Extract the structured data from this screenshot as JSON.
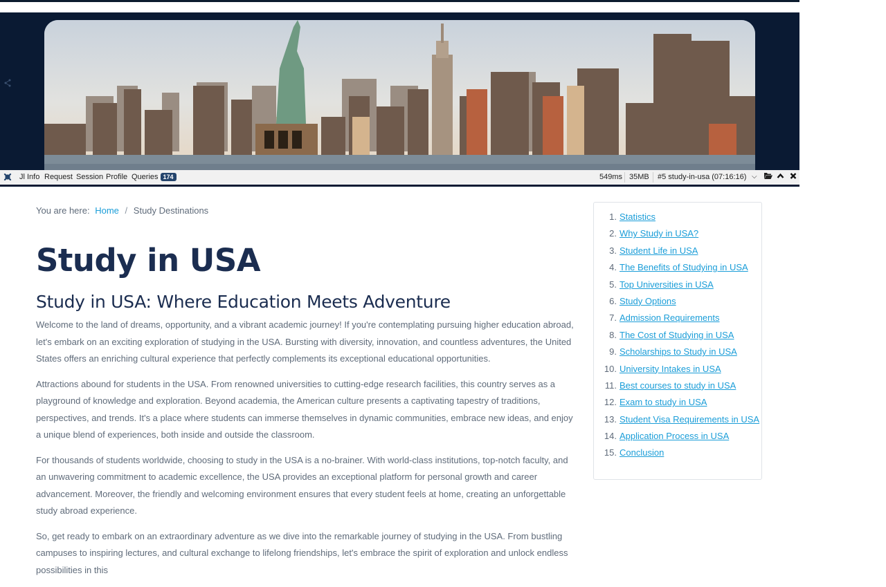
{
  "debugbar": {
    "items": [
      "Jl Info",
      "Request",
      "Session",
      "Profile",
      "Queries"
    ],
    "queries_count": "174",
    "time": "549ms",
    "memory": "35MB",
    "request": "#5 study-in-usa (07:16:16)"
  },
  "breadcrumb": {
    "prefix": "You are here:",
    "home": "Home",
    "separator": "/",
    "current": "Study Destinations"
  },
  "page": {
    "title": "Study in USA",
    "subtitle": "Study in USA: Where Education Meets Adventure",
    "paragraphs": [
      "Welcome to the land of dreams, opportunity, and a vibrant academic journey! If you're contemplating pursuing higher education abroad, let's embark on an exciting exploration of studying in the USA. Bursting with diversity, innovation, and countless adventures, the United States offers an enriching cultural experience that perfectly complements its exceptional educational opportunities.",
      "Attractions abound for students in the USA. From renowned universities to cutting-edge research facilities, this country serves as a playground of knowledge and exploration. Beyond academia, the American culture presents a captivating tapestry of traditions, perspectives, and trends. It's a place where students can immerse themselves in dynamic communities, embrace new ideas, and enjoy a unique blend of experiences, both inside and outside the classroom.",
      "For thousands of students worldwide, choosing to study in the USA is a no-brainer. With world-class institutions, top-notch faculty, and an unwavering commitment to academic excellence, the USA provides an exceptional platform for personal growth and career advancement. Moreover, the friendly and welcoming environment ensures that every student feels at home, creating an unforgettable study abroad experience.",
      "So, get ready to embark on an extraordinary adventure as we dive into the remarkable journey of studying in the USA. From bustling campuses to inspiring lectures, and cultural exchange to lifelong friendships, let's embrace the spirit of exploration and unlock endless possibilities in this"
    ]
  },
  "toc": {
    "items": [
      {
        "num": "1.",
        "label": "Statistics"
      },
      {
        "num": "2.",
        "label": "Why Study in USA?"
      },
      {
        "num": "3.",
        "label": "Student Life in USA"
      },
      {
        "num": "4.",
        "label": "The Benefits of Studying in USA"
      },
      {
        "num": "5.",
        "label": "Top Universities in USA"
      },
      {
        "num": "6.",
        "label": "Study Options"
      },
      {
        "num": "7.",
        "label": "Admission Requirements"
      },
      {
        "num": "8.",
        "label": "The Cost of Studying in USA"
      },
      {
        "num": "9.",
        "label": "Scholarships to Study in USA"
      },
      {
        "num": "10.",
        "label": "University Intakes in USA"
      },
      {
        "num": "11.",
        "label": "Best courses to study in USA"
      },
      {
        "num": "12.",
        "label": "Exam to study in USA"
      },
      {
        "num": "13.",
        "label": "Student Visa Requirements in USA"
      },
      {
        "num": "14.",
        "label": "Application Process in USA"
      },
      {
        "num": "15.",
        "label": "Conclusion"
      }
    ]
  },
  "colors": {
    "navy": "#0a1a33",
    "heading": "#1b2d50",
    "link": "#1a9dd8",
    "body_text": "#5f6b7a"
  },
  "icons": [
    "share-icon",
    "joomla-logo-icon",
    "chevron-down-icon",
    "folder-open-icon",
    "chevron-up-icon",
    "close-icon"
  ]
}
